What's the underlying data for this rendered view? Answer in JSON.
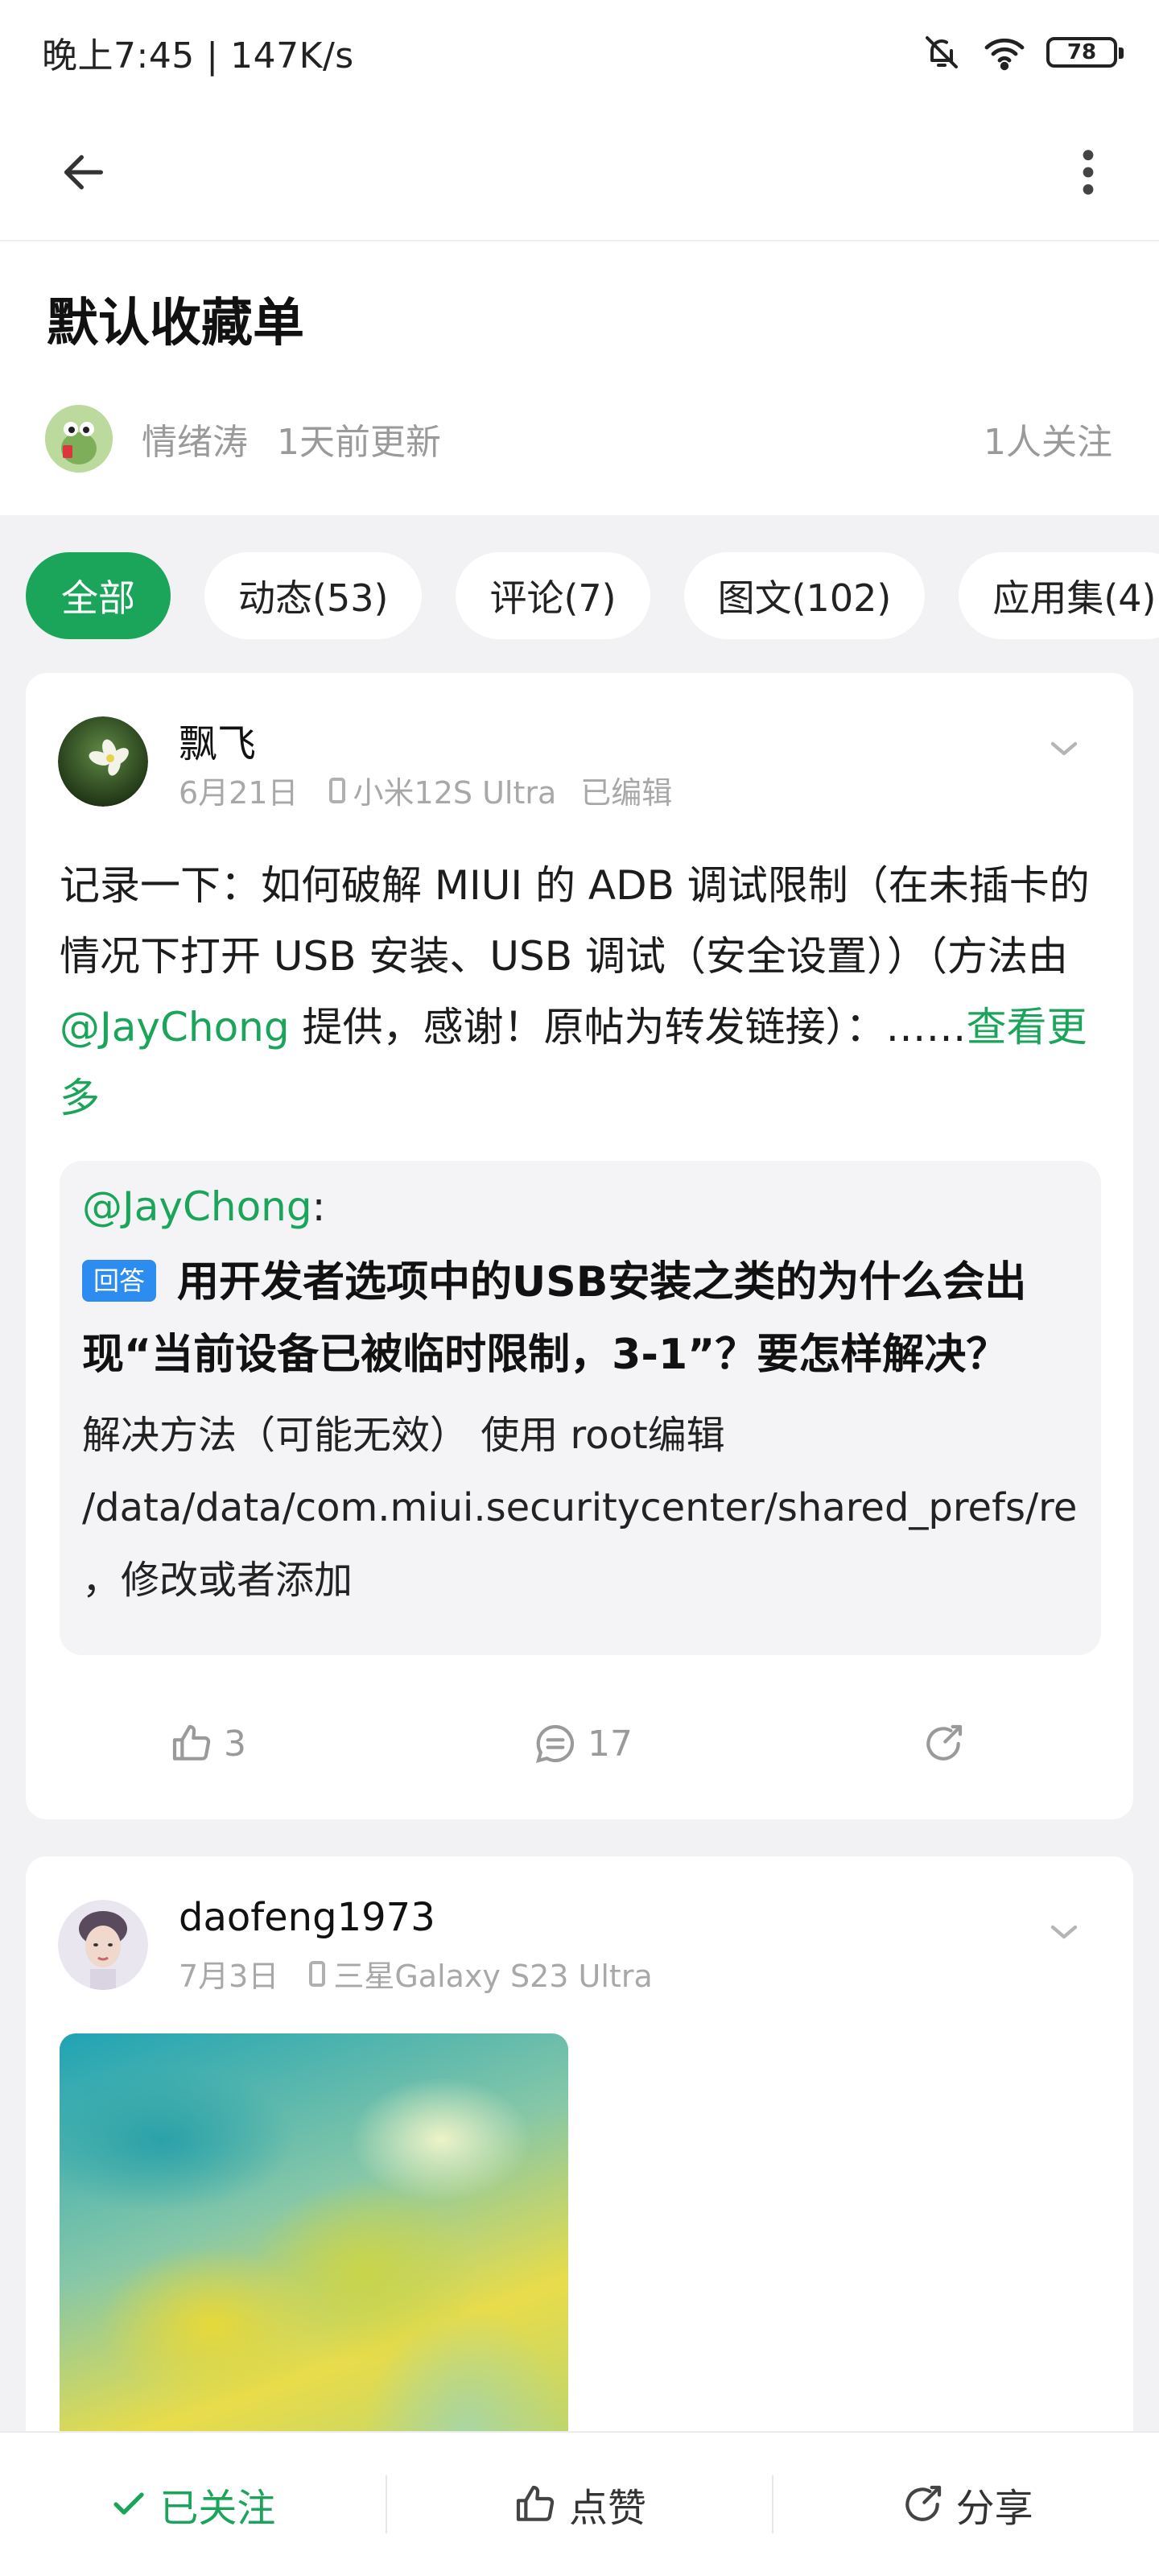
{
  "status_bar": {
    "time_speed": "晚上7:45 | 147K/s",
    "battery": "78"
  },
  "page": {
    "title": "默认收藏单",
    "owner_name": "情绪涛",
    "updated": "1天前更新",
    "followers": "1人关注"
  },
  "tabs": [
    {
      "label": "全部",
      "active": true
    },
    {
      "label": "动态(53)",
      "active": false
    },
    {
      "label": "评论(7)",
      "active": false
    },
    {
      "label": "图文(102)",
      "active": false
    },
    {
      "label": "应用集(4)",
      "active": false
    }
  ],
  "posts": [
    {
      "author": "飘飞",
      "date": "6月21日",
      "device": "小米12S Ultra",
      "edited": "已编辑",
      "body_part1": "记录一下：如何破解 MIUI 的 ADB 调试限制（在未插卡的情况下打开 USB 安装、USB 调试（安全设置））（方法由 ",
      "body_mention": "@JayChong",
      "body_part2": " 提供，感谢！原帖为转发链接）：……",
      "see_more": "查看更多",
      "quote": {
        "mention": "@JayChong",
        "colon": ":",
        "badge": "回答",
        "title": "用开发者选项中的USB安装之类的为什么会出现“当前设备已被临时限制，3-1”？要怎样解决？",
        "text": "解决方法（可能无效） 使用 root编辑 /data/data/com.miui.securitycenter/shared_prefs/remote_provider_preferences.xml ，修改或者添加"
      },
      "likes": "3",
      "comments": "17"
    },
    {
      "author": "daofeng1973",
      "date": "7月3日",
      "device": "三星Galaxy S23 Ultra"
    }
  ],
  "bottom_bar": {
    "follow": "已关注",
    "like": "点赞",
    "share": "分享"
  },
  "colors": {
    "accent": "#1aa55a",
    "badge": "#2d8cf0",
    "feed_bg": "#f2f2f5"
  },
  "icons": [
    "back-arrow-icon",
    "more-vert-icon",
    "mute-bell-icon",
    "wifi-icon",
    "battery-icon",
    "chevron-down-icon",
    "thumb-up-icon",
    "comment-icon",
    "share-icon",
    "check-icon",
    "phone-icon"
  ]
}
